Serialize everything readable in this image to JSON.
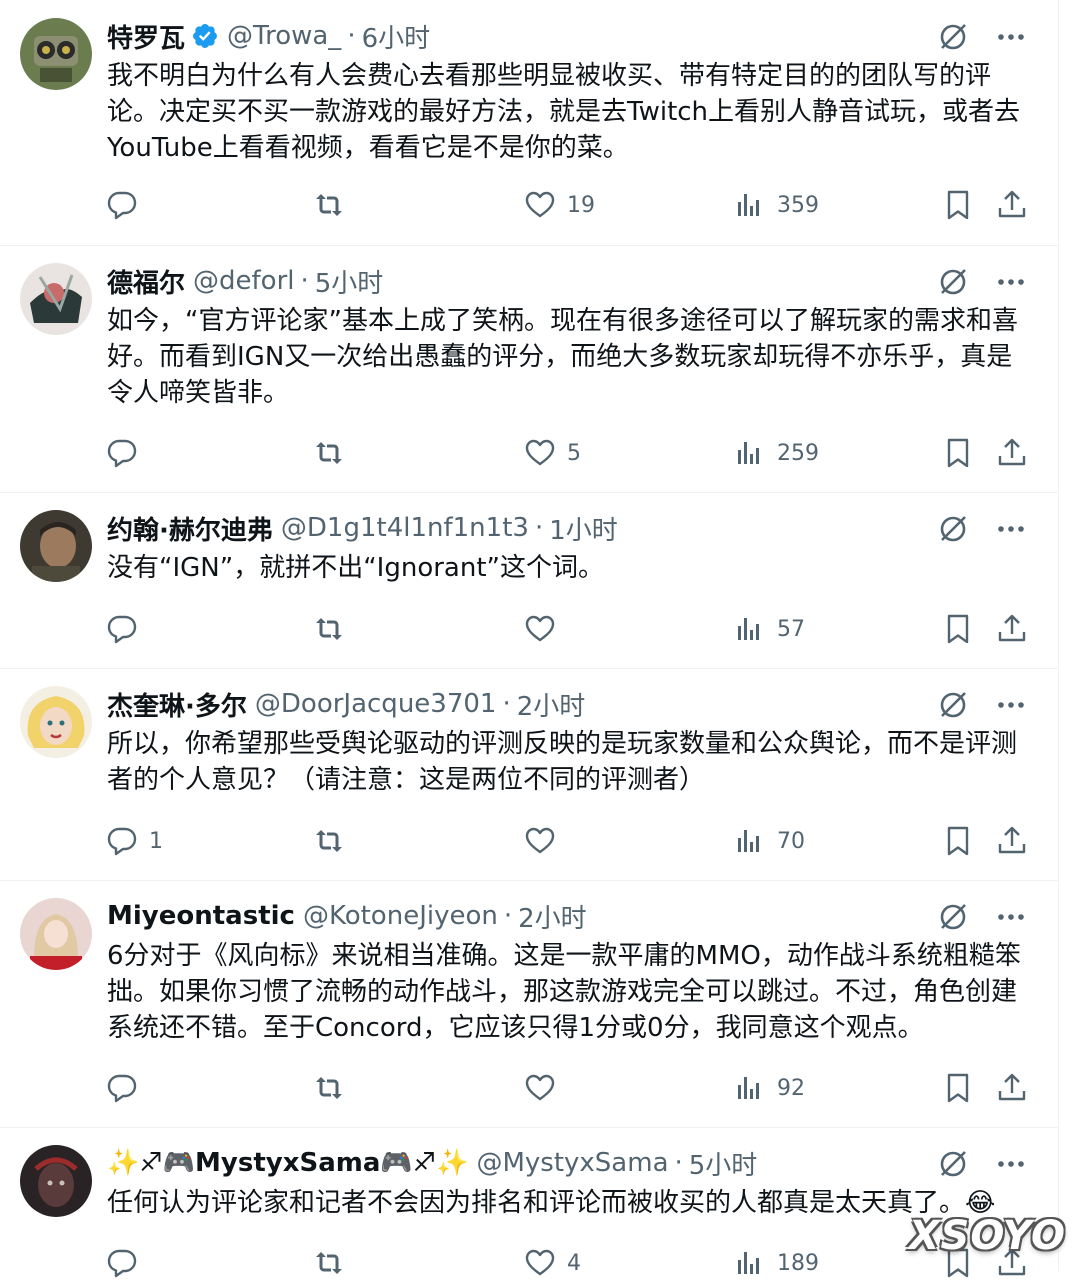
{
  "colors": {
    "text": "#0f1419",
    "secondary": "#536471",
    "verified": "#1d9bf0",
    "divider": "#eff3f4"
  },
  "tweets": [
    {
      "name": "特罗瓦",
      "verified": true,
      "handle": "@Trowa_",
      "sep": "·",
      "time": "6小时",
      "text": "我不明白为什么有人会费心去看那些明显被收买、带有特定目的的团队写的评论。决定买不买一款游戏的最好方法，就是去Twitch上看别人静音试玩，或者去YouTube上看看视频，看看它是不是你的菜。",
      "reply_count": "",
      "retweet_count": "",
      "like_count": "19",
      "view_count": "359"
    },
    {
      "name": "德福尔",
      "verified": false,
      "handle": "@deforl",
      "sep": "·",
      "time": "5小时",
      "text": "如今，“官方评论家”基本上成了笑柄。现在有很多途径可以了解玩家的需求和喜好。而看到IGN又一次给出愚蠢的评分，而绝大多数玩家却玩得不亦乐乎，真是令人啼笑皆非。",
      "reply_count": "",
      "retweet_count": "",
      "like_count": "5",
      "view_count": "259"
    },
    {
      "name": "约翰·赫尔迪弗",
      "verified": false,
      "handle": "@D1g1t4l1nf1n1t3",
      "sep": "·",
      "time": "1小时",
      "text": "没有“IGN”，就拼不出“Ignorant”这个词。",
      "reply_count": "",
      "retweet_count": "",
      "like_count": "",
      "view_count": "57"
    },
    {
      "name": "杰奎琳·多尔",
      "verified": false,
      "handle": "@DoorJacque3701",
      "sep": "·",
      "time": "2小时",
      "text": "所以，你希望那些受舆论驱动的评测反映的是玩家数量和公众舆论，而不是评测者的个人意见？（请注意：这是两位不同的评测者）",
      "reply_count": "1",
      "retweet_count": "",
      "like_count": "",
      "view_count": "70"
    },
    {
      "name": "Miyeontastic",
      "verified": false,
      "handle": "@KotoneJiyeon",
      "sep": "·",
      "time": "2小时",
      "text": "6分对于《风向标》来说相当准确。这是一款平庸的MMO，动作战斗系统粗糙笨拙。如果你习惯了流畅的动作战斗，那这款游戏完全可以跳过。不过，角色创建系统还不错。至于Concord，它应该只得1分或0分，我同意这个观点。",
      "reply_count": "",
      "retweet_count": "",
      "like_count": "",
      "view_count": "92"
    },
    {
      "name": "✨♐🎮MystyxSama🎮♐✨",
      "verified": false,
      "handle": "@MystyxSama",
      "sep": "·",
      "time": "5小时",
      "text": "任何认为评论家和记者不会因为排名和评论而被收买的人都真是太天真了。😂",
      "reply_count": "",
      "retweet_count": "",
      "like_count": "4",
      "view_count": "189"
    }
  ],
  "watermark": "XSOYO"
}
